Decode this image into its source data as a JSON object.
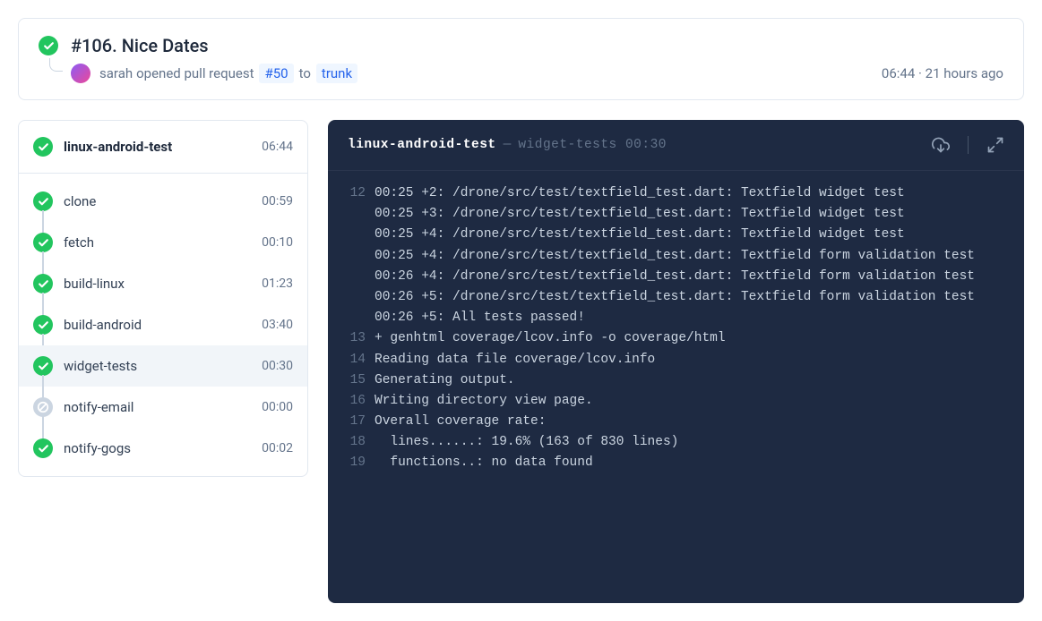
{
  "build": {
    "title": "#106. Nice Dates",
    "author": "sarah",
    "action": "opened pull request",
    "pr_label": "#50",
    "to_word": "to",
    "target_branch": "trunk",
    "time": "06:44",
    "relative": "21 hours ago",
    "sep": " · "
  },
  "pipeline": {
    "name": "linux-android-test",
    "duration": "06:44",
    "steps": [
      {
        "name": "clone",
        "duration": "00:59",
        "status": "success"
      },
      {
        "name": "fetch",
        "duration": "00:10",
        "status": "success"
      },
      {
        "name": "build-linux",
        "duration": "01:23",
        "status": "success"
      },
      {
        "name": "build-android",
        "duration": "03:40",
        "status": "success"
      },
      {
        "name": "widget-tests",
        "duration": "00:30",
        "status": "success",
        "active": true
      },
      {
        "name": "notify-email",
        "duration": "00:00",
        "status": "skipped"
      },
      {
        "name": "notify-gogs",
        "duration": "00:02",
        "status": "success"
      }
    ]
  },
  "terminal": {
    "title": "linux-android-test",
    "separator": "—",
    "subtitle_step": "widget-tests",
    "subtitle_time": "00:30",
    "lines": [
      {
        "no": "12",
        "text": "00:25 +2: /drone/src/test/textfield_test.dart: Textfield widget test\n00:25 +3: /drone/src/test/textfield_test.dart: Textfield widget test\n00:25 +4: /drone/src/test/textfield_test.dart: Textfield widget test\n00:25 +4: /drone/src/test/textfield_test.dart: Textfield form validation test\n00:26 +4: /drone/src/test/textfield_test.dart: Textfield form validation test\n00:26 +5: /drone/src/test/textfield_test.dart: Textfield form validation test\n00:26 +5: All tests passed!"
      },
      {
        "no": "13",
        "text": "+ genhtml coverage/lcov.info -o coverage/html"
      },
      {
        "no": "14",
        "text": "Reading data file coverage/lcov.info"
      },
      {
        "no": "15",
        "text": "Generating output."
      },
      {
        "no": "16",
        "text": "Writing directory view page."
      },
      {
        "no": "17",
        "text": "Overall coverage rate:"
      },
      {
        "no": "18",
        "text": "  lines......: 19.6% (163 of 830 lines)"
      },
      {
        "no": "19",
        "text": "  functions..: no data found"
      }
    ]
  }
}
